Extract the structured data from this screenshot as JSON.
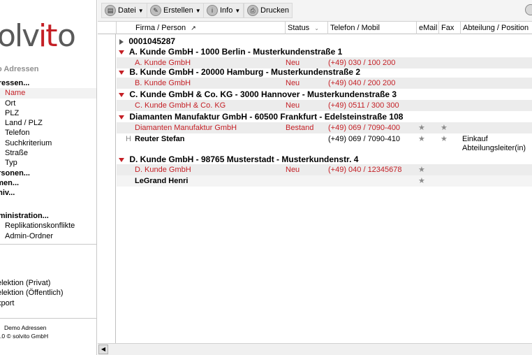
{
  "logo": {
    "part1": "olv",
    "part2": "it",
    "part3": "o"
  },
  "sidebar": {
    "app_name": "o Adressen",
    "items": [
      {
        "label": "dressen...",
        "level": 1
      },
      {
        "label": "Name",
        "level": 2,
        "active": true
      },
      {
        "label": "Ort",
        "level": 2
      },
      {
        "label": "PLZ",
        "level": 2
      },
      {
        "label": "Land / PLZ",
        "level": 2
      },
      {
        "label": "Telefon",
        "level": 2
      },
      {
        "label": "Suchkriterium",
        "level": 2
      },
      {
        "label": "Straße",
        "level": 2
      },
      {
        "label": "Typ",
        "level": 2
      },
      {
        "label": "ersonen...",
        "level": 1
      },
      {
        "label": "rmen...",
        "level": 1
      },
      {
        "label": "chiv...",
        "level": 1
      }
    ],
    "admin": [
      {
        "label": "dministration...",
        "level": 1
      },
      {
        "label": "Replikationskonflikte",
        "level": 2
      },
      {
        "label": "Admin-Ordner",
        "level": 2
      }
    ],
    "selections": [
      {
        "label": "elektion (Privat)"
      },
      {
        "label": "elektion (Öffentlich)"
      },
      {
        "label": "xport"
      }
    ],
    "footer_line1": "Demo Adressen",
    "footer_line2": ".0 © solvito GmbH"
  },
  "toolbar": {
    "datei": "Datei",
    "erstellen": "Erstellen",
    "info": "Info",
    "drucken": "Drucken"
  },
  "columns": {
    "firma": "Firma / Person",
    "status": "Status",
    "telefon": "Telefon / Mobil",
    "email": "eMail",
    "fax": "Fax",
    "abteilung": "Abteilung / Position"
  },
  "rows": {
    "r0": {
      "label": "0001045287"
    },
    "r1": {
      "label": "A. Kunde GmbH - 1000 Berlin - Musterkundenstraße 1"
    },
    "r2": {
      "name": "A. Kunde GmbH",
      "status": "Neu",
      "telefon": "(+49) 030 / 100 200"
    },
    "r3": {
      "label": "B. Kunde GmbH - 20000 Hamburg - Musterkundenstraße 2"
    },
    "r4": {
      "name": "B. Kunde GmbH",
      "status": "Neu",
      "telefon": "(+49) 040 / 200 200"
    },
    "r5": {
      "label": "C. Kunde GmbH & Co. KG - 3000 Hannover - Musterkundenstraße 3"
    },
    "r6": {
      "name": "C. Kunde GmbH & Co. KG",
      "status": "Neu",
      "telefon": "(+49) 0511 / 300 300"
    },
    "r7": {
      "label": "Diamanten Manufaktur GmbH - 60500 Frankfurt - Edelsteinstraße 108"
    },
    "r8": {
      "name": "Diamanten Manufaktur GmbH",
      "status": "Bestand",
      "telefon": "(+49) 069 / 7090-400",
      "email": "★",
      "fax": "★"
    },
    "r9": {
      "marker": "H",
      "name": "Reuter Stefan",
      "telefon": "(+49) 069 / 7090-410",
      "email": "★",
      "fax": "★",
      "abteilung1": "Einkauf",
      "abteilung2": "Abteilungsleiter(in)"
    },
    "r10": {
      "label": "D. Kunde GmbH - 98765 Musterstadt - Musterkundenstr. 4"
    },
    "r11": {
      "name": "D. Kunde GmbH",
      "status": "Neu",
      "telefon": "(+49) 040 / 12345678",
      "email": "★"
    },
    "r12": {
      "name": "LeGrand Henri",
      "email": "★"
    }
  }
}
